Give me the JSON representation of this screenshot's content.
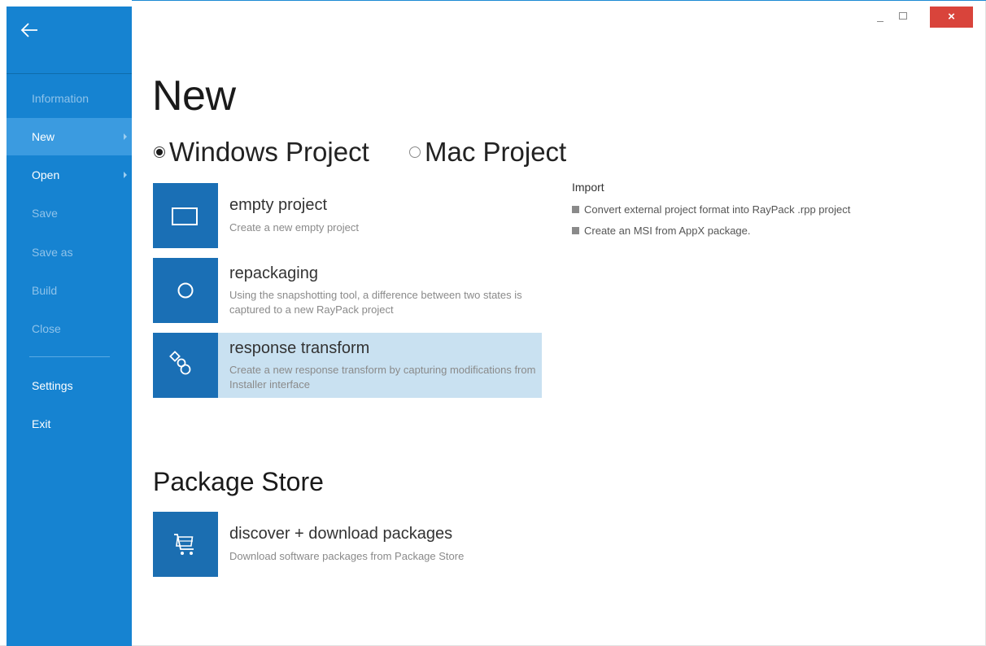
{
  "sidebar": {
    "items": [
      {
        "label": "Information",
        "enabled": false
      },
      {
        "label": "New",
        "enabled": true
      },
      {
        "label": "Open",
        "enabled": true
      },
      {
        "label": "Save",
        "enabled": false
      },
      {
        "label": "Save as",
        "enabled": false
      },
      {
        "label": "Build",
        "enabled": false
      },
      {
        "label": "Close",
        "enabled": false
      },
      {
        "label": "Settings",
        "enabled": true
      },
      {
        "label": "Exit",
        "enabled": true
      }
    ]
  },
  "window": {
    "close_label": "×"
  },
  "main": {
    "title": "New",
    "project_types": [
      {
        "label": "Windows Project",
        "selected": true
      },
      {
        "label": "Mac Project",
        "selected": false
      }
    ],
    "tiles": [
      {
        "title": "empty project",
        "description": "Create a new empty project"
      },
      {
        "title": "repackaging",
        "description": "Using the snapshotting tool, a difference between two states is captured to a new RayPack project"
      },
      {
        "title": "response transform",
        "description": "Create a new response transform by capturing modifications from Installer interface"
      }
    ],
    "import": {
      "heading": "Import",
      "items": [
        "Convert external project format into RayPack .rpp project",
        "Create an MSI from AppX package."
      ]
    },
    "store": {
      "title": "Package Store",
      "tile": {
        "title": "discover + download packages",
        "description": "Download software packages from Package Store"
      }
    }
  },
  "colors": {
    "sidebar": "#1683d1",
    "active_item": "#3b9be0",
    "tile_icon": "#1a6fb5",
    "tile_hover": "#c9e1f1",
    "close_button": "#d9443b"
  }
}
